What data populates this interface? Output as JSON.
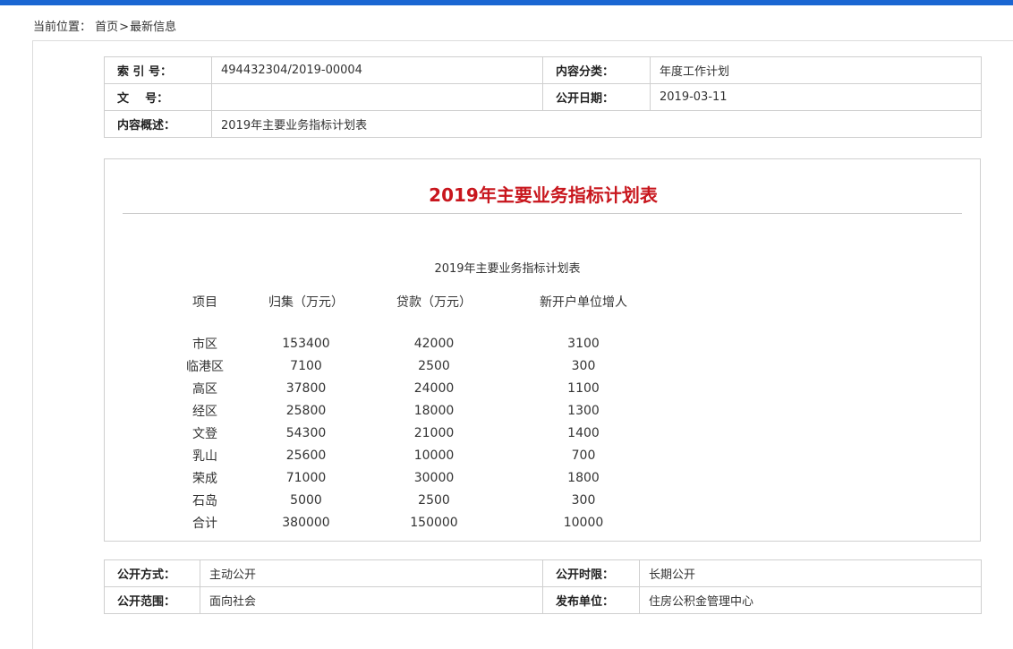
{
  "breadcrumb": {
    "label": "当前位置：",
    "home": "首页",
    "separator": ">",
    "current": "最新信息"
  },
  "meta_top": {
    "index_label": "索 引 号：",
    "index_value": "494432304/2019-00004",
    "category_label": "内容分类：",
    "category_value": "年度工作计划",
    "doc_no_label": "文    号：",
    "doc_no_value": "",
    "date_label": "公开日期：",
    "date_value": "2019-03-11",
    "summary_label": "内容概述：",
    "summary_value": "2019年主要业务指标计划表"
  },
  "article": {
    "title": "2019年主要业务指标计划表",
    "table_title": "2019年主要业务指标计划表",
    "headers": [
      "项目",
      "归集（万元）",
      "贷款（万元）",
      "新开户单位增人"
    ],
    "rows": [
      [
        "市区",
        "153400",
        "42000",
        "3100"
      ],
      [
        "临港区",
        "7100",
        "2500",
        "300"
      ],
      [
        "高区",
        "37800",
        "24000",
        "1100"
      ],
      [
        "经区",
        "25800",
        "18000",
        "1300"
      ],
      [
        "文登",
        "54300",
        "21000",
        "1400"
      ],
      [
        "乳山",
        "25600",
        "10000",
        "700"
      ],
      [
        "荣成",
        "71000",
        "30000",
        "1800"
      ],
      [
        "石岛",
        "5000",
        "2500",
        "300"
      ],
      [
        "合计",
        "380000",
        "150000",
        "10000"
      ]
    ]
  },
  "meta_bottom": {
    "method_label": "公开方式：",
    "method_value": "主动公开",
    "period_label": "公开时限：",
    "period_value": "长期公开",
    "scope_label": "公开范围：",
    "scope_value": "面向社会",
    "publisher_label": "发布单位：",
    "publisher_value": "住房公积金管理中心"
  },
  "colors": {
    "topbar": "#1a66d2",
    "title": "#c8161d",
    "border": "#cfcfcf"
  }
}
